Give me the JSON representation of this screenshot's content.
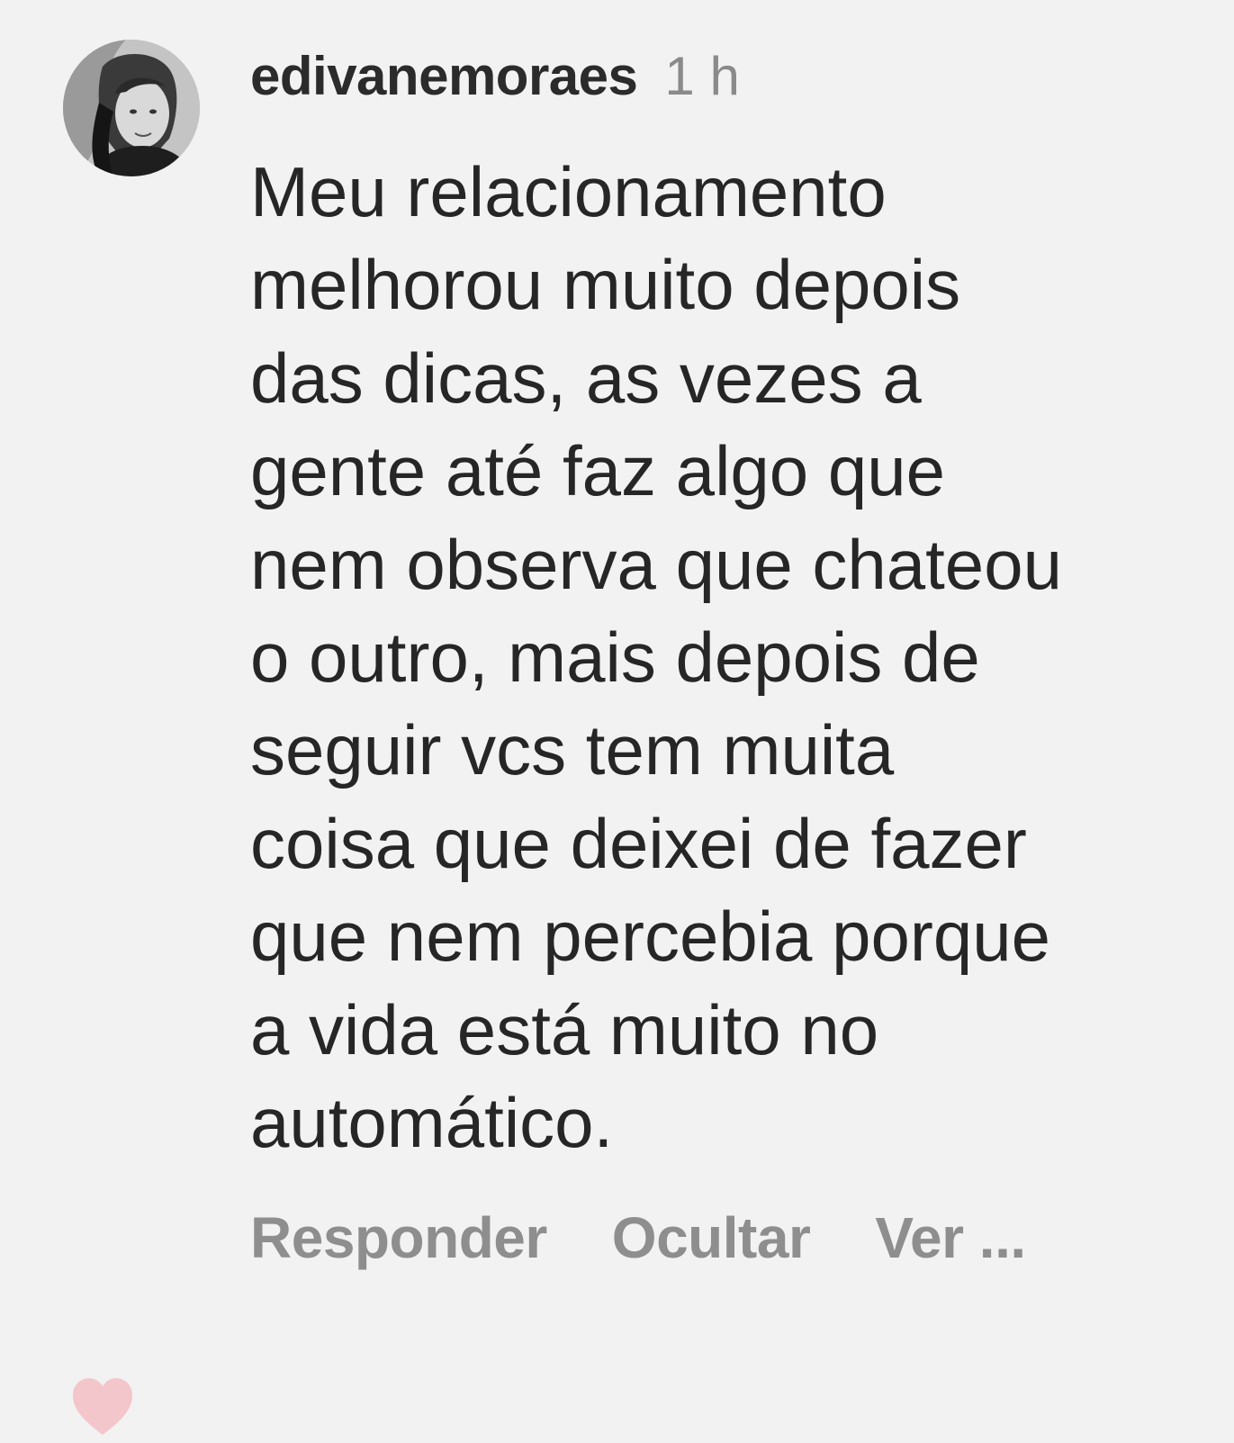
{
  "comment": {
    "username": "edivanemoraes",
    "time": "1 h",
    "lines": [
      "Meu relacionamento",
      "melhorou muito depois",
      "das dicas, as vezes a",
      "gente até faz algo que",
      "nem observa que chateou",
      "o outro, mais depois de",
      "seguir vcs tem muita",
      "coisa que deixei de fazer",
      "que nem percebia porque",
      "a vida está muito no",
      "automático."
    ],
    "actions": {
      "reply": "Responder",
      "hide": "Ocultar",
      "more": "Ver ..."
    }
  },
  "colors": {
    "background": "#f2f2f2",
    "text": "#262626",
    "muted": "#8e8e8e",
    "heart": "#f3c6cb"
  },
  "icons": {
    "avatar": "profile-photo",
    "heart": "heart-icon"
  }
}
